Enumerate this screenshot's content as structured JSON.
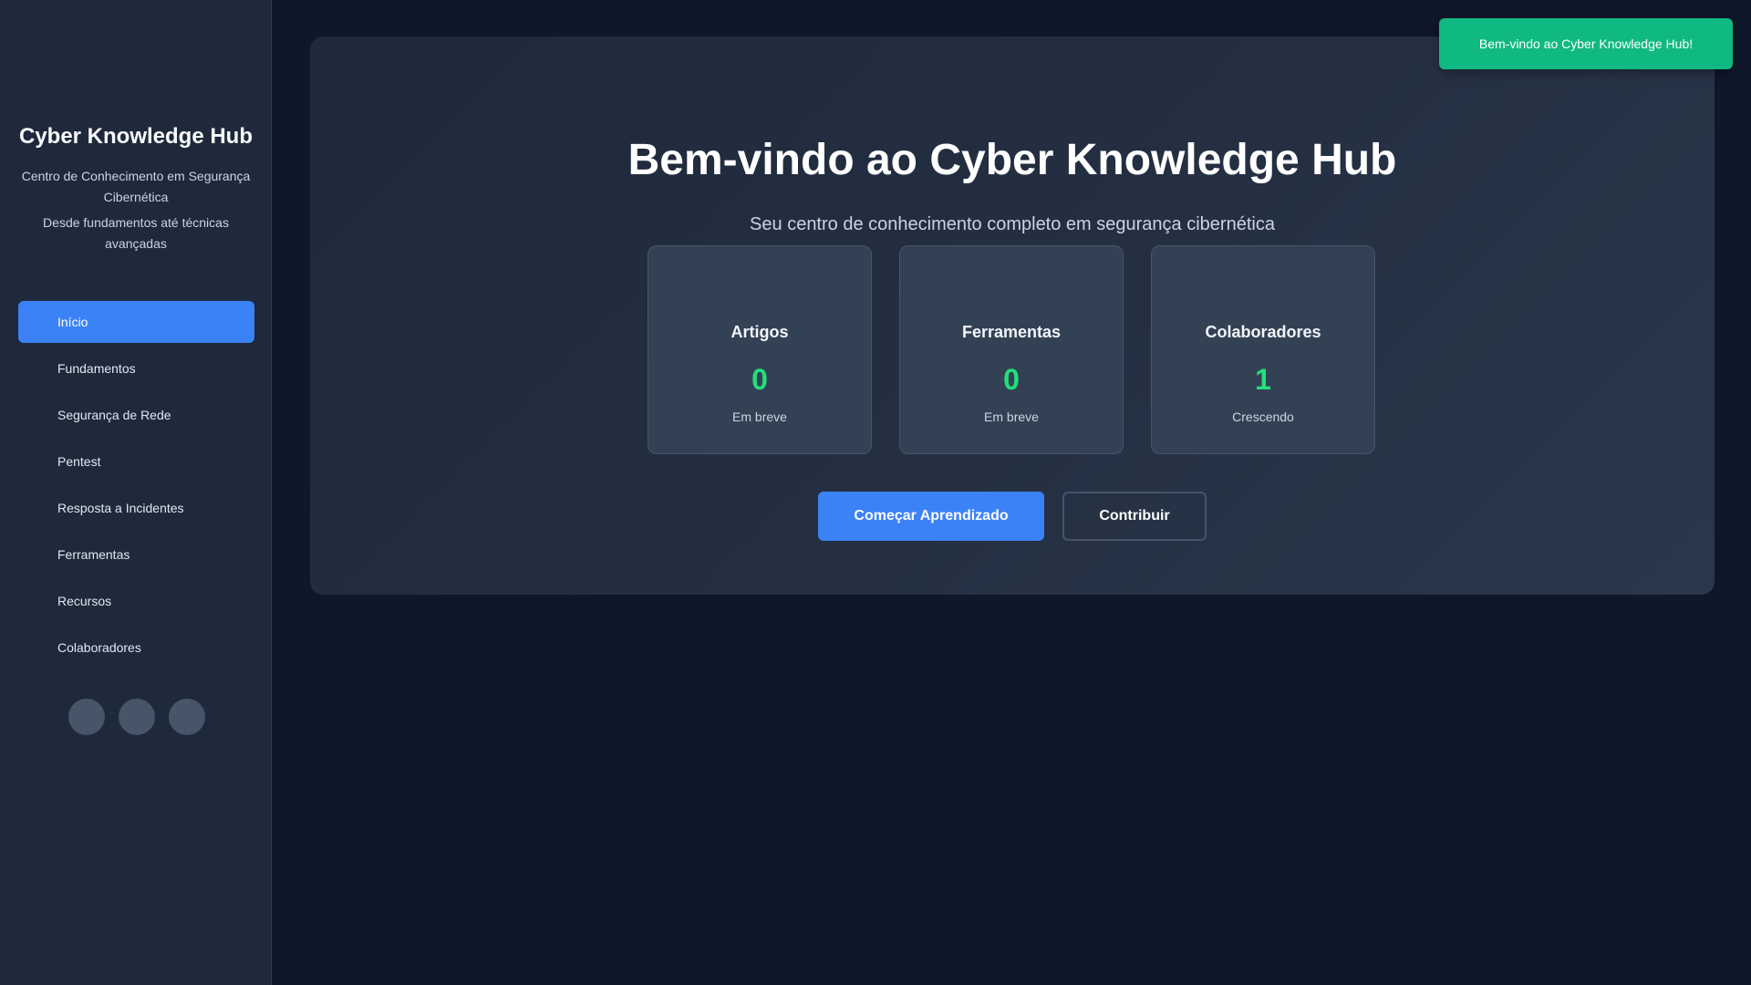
{
  "sidebar": {
    "title": "Cyber Knowledge Hub",
    "subtitle_1": "Centro de Conhecimento em Segurança Cibernética",
    "subtitle_2": "Desde fundamentos até técnicas avançadas",
    "items": [
      {
        "label": "Início",
        "active": true
      },
      {
        "label": "Fundamentos"
      },
      {
        "label": "Segurança de Rede"
      },
      {
        "label": "Pentest"
      },
      {
        "label": "Resposta a Incidentes"
      },
      {
        "label": "Ferramentas"
      },
      {
        "label": "Recursos"
      },
      {
        "label": "Colaboradores"
      }
    ],
    "socials": [
      {
        "icon": "social-icon"
      },
      {
        "icon": "social-icon"
      },
      {
        "icon": "social-icon"
      }
    ]
  },
  "hero": {
    "title": "Bem-vindo ao Cyber Knowledge Hub",
    "subtitle": "Seu centro de conhecimento completo em segurança cibernética",
    "stats": [
      {
        "label": "Artigos",
        "value": "0",
        "note": "Em breve"
      },
      {
        "label": "Ferramentas",
        "value": "0",
        "note": "Em breve"
      },
      {
        "label": "Colaboradores",
        "value": "1",
        "note": "Crescendo"
      }
    ],
    "primary_button": "Começar Aprendizado",
    "secondary_button": "Contribuir"
  },
  "toast": {
    "message": "Bem-vindo ao Cyber Knowledge Hub!"
  },
  "colors": {
    "background": "#0f172a",
    "sidebar": "#1e293b",
    "accent": "#3b82f6",
    "success": "#10b981",
    "stat_value": "#22e07a"
  }
}
